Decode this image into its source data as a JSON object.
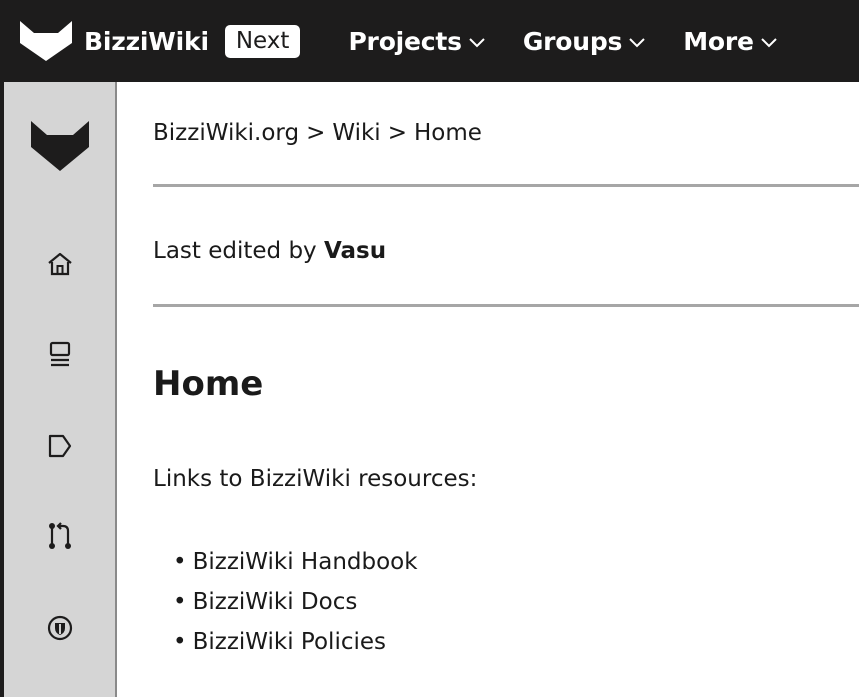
{
  "topbar": {
    "brand_name": "BizziWiki",
    "next_label": "Next",
    "nav": [
      {
        "label": "Projects"
      },
      {
        "label": "Groups"
      },
      {
        "label": "More"
      }
    ]
  },
  "sidebar": {
    "icons": [
      "fox-logo-icon",
      "home-icon",
      "monitor-icon",
      "issues-icon",
      "merge-request-icon",
      "security-shield-icon"
    ]
  },
  "breadcrumb": {
    "items": [
      "BizziWiki.org",
      "Wiki",
      "Home"
    ],
    "separator": ">"
  },
  "meta": {
    "prefix": "Last edited by",
    "author": "Vasu"
  },
  "page": {
    "title": "Home",
    "intro": "Links to BizziWiki resources:",
    "links": [
      {
        "label": "BizziWiki Handbook"
      },
      {
        "label": "BizziWiki Docs"
      },
      {
        "label": "BizziWiki Policies"
      }
    ]
  },
  "colors": {
    "topbar_bg": "#1d1c1c",
    "sidebar_bg": "#d5d5d5",
    "divider": "#a6a6a6"
  }
}
